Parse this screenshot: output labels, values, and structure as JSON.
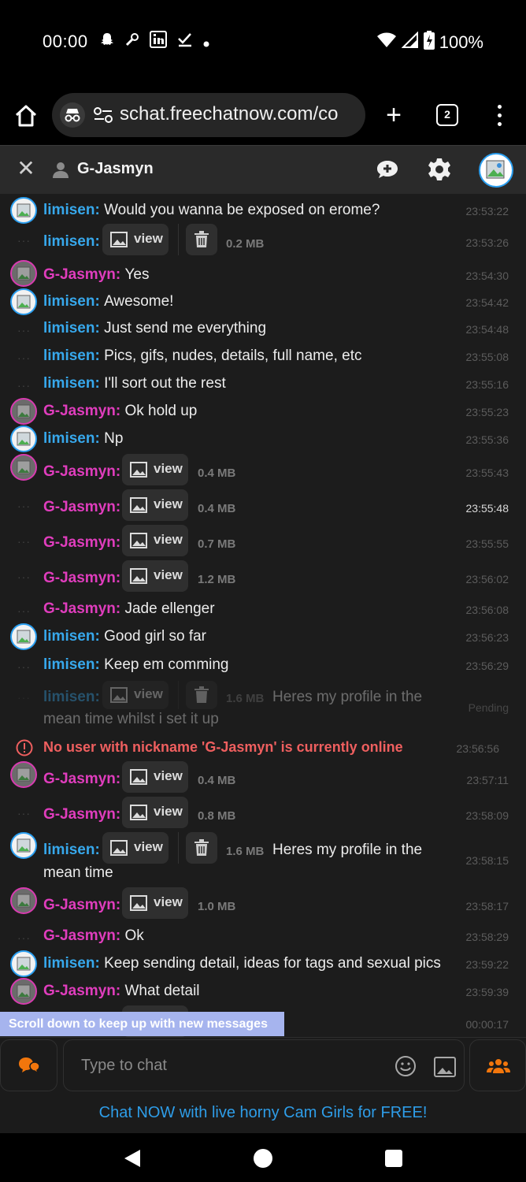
{
  "status_bar": {
    "time": "00:00",
    "battery": "100%"
  },
  "browser": {
    "url": "schat.freechatnow.com/co",
    "tab_count": "2"
  },
  "chat_header": {
    "title": "G-Jasmyn"
  },
  "messages": [
    {
      "nick": "limisen:",
      "text": "Would you wanna be exposed on erome?",
      "time": "23:53:22"
    },
    {
      "nick": "limisen:",
      "view": "view",
      "size": "0.2 MB",
      "time": "23:53:26"
    },
    {
      "nick": "G-Jasmyn:",
      "text": "Yes",
      "time": "23:54:30"
    },
    {
      "nick": "limisen:",
      "text": "Awesome!",
      "time": "23:54:42"
    },
    {
      "nick": "limisen:",
      "text": "Just send me everything",
      "time": "23:54:48"
    },
    {
      "nick": "limisen:",
      "text": "Pics, gifs, nudes, details, full name, etc",
      "time": "23:55:08"
    },
    {
      "nick": "limisen:",
      "text": "I'll sort out the rest",
      "time": "23:55:16"
    },
    {
      "nick": "G-Jasmyn:",
      "text": "Ok hold up",
      "time": "23:55:23"
    },
    {
      "nick": "limisen:",
      "text": "Np",
      "time": "23:55:36"
    },
    {
      "nick": "G-Jasmyn:",
      "view": "view",
      "size": "0.4 MB",
      "time": "23:55:43"
    },
    {
      "nick": "G-Jasmyn:",
      "view": "view",
      "size": "0.4 MB",
      "time": "23:55:48"
    },
    {
      "nick": "G-Jasmyn:",
      "view": "view",
      "size": "0.7 MB",
      "time": "23:55:55"
    },
    {
      "nick": "G-Jasmyn:",
      "view": "view",
      "size": "1.2 MB",
      "time": "23:56:02"
    },
    {
      "nick": "G-Jasmyn:",
      "text": "Jade ellenger",
      "time": "23:56:08"
    },
    {
      "nick": "limisen:",
      "text": "Good girl so far",
      "time": "23:56:23"
    },
    {
      "nick": "limisen:",
      "text": "Keep em comming",
      "time": "23:56:29"
    },
    {
      "nick": "limisen:",
      "view": "view",
      "size": "1.6 MB",
      "text": "Heres my profile in the",
      "text2": "mean time whilst i set it up",
      "time": "Pending"
    },
    {
      "error": "No user with nickname 'G-Jasmyn' is currently online",
      "time": "23:56:56"
    },
    {
      "nick": "G-Jasmyn:",
      "view": "view",
      "size": "0.4 MB",
      "time": "23:57:11"
    },
    {
      "nick": "G-Jasmyn:",
      "view": "view",
      "size": "0.8 MB",
      "time": "23:58:09"
    },
    {
      "nick": "limisen:",
      "view": "view",
      "size": "1.6 MB",
      "text": "Heres my profile in the",
      "text2": "mean time",
      "time": "23:58:15"
    },
    {
      "nick": "G-Jasmyn:",
      "view": "view",
      "size": "1.0 MB",
      "time": "23:58:17"
    },
    {
      "nick": "G-Jasmyn:",
      "text": "Ok",
      "time": "23:58:29"
    },
    {
      "nick": "limisen:",
      "text": "Keep sending detail, ideas for tags and sexual pics",
      "time": "23:59:22"
    },
    {
      "nick": "G-Jasmyn:",
      "text": "What detail",
      "time": "23:59:39"
    },
    {
      "time": "00:00:17"
    }
  ],
  "scroll_banner": "Scroll down to keep up with new messages",
  "input": {
    "placeholder": "Type to chat"
  },
  "promo": "Chat NOW with live horny Cam Girls for FREE!",
  "colors": {
    "limisen": "#37a8ec",
    "g_jasmyn": "#e03dbd",
    "error": "#ef5f5f",
    "link": "#2e9de8"
  }
}
